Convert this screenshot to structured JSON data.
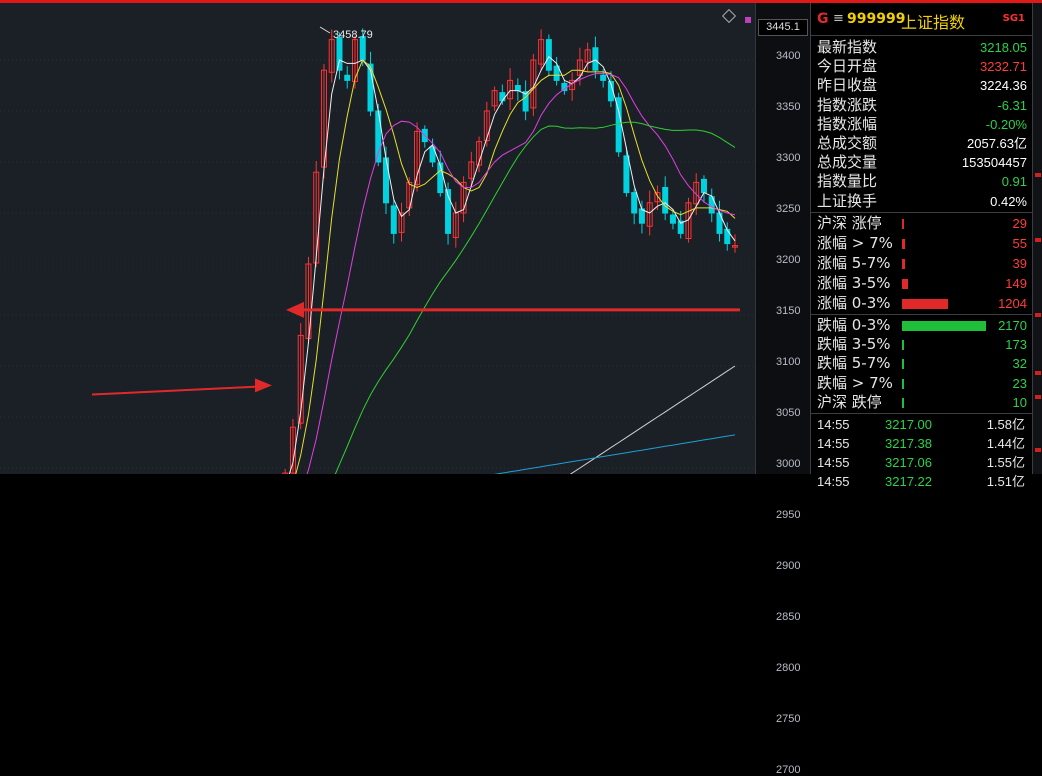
{
  "axis": {
    "top_box": "3445.1",
    "ticks": [
      "3400",
      "3350",
      "3300",
      "3250",
      "3200",
      "3150",
      "3100",
      "3050",
      "3000",
      "2950",
      "2900",
      "2850",
      "2800",
      "2750",
      "2700"
    ]
  },
  "chart": {
    "high_label": "3458.79",
    "colors": {
      "up": "#ff3333",
      "down": "#00d2e0",
      "ma5": "#f0f0f0",
      "ma10": "#e6e02a",
      "ma20": "#e040e0",
      "ma60": "#30d030",
      "ma120": "#d0d0d0",
      "ma250": "#1fa0d8",
      "arrow": "#e02a2a"
    }
  },
  "panel": {
    "g": "G",
    "menu_icon": "menu-icon",
    "code": "999999",
    "name": "上证指数",
    "sg": "SG1",
    "stats": [
      {
        "label": "最新指数",
        "value": "3218.05",
        "color": "#2ad24a"
      },
      {
        "label": "今日开盘",
        "value": "3232.71",
        "color": "#ff3b3b"
      },
      {
        "label": "昨日收盘",
        "value": "3224.36",
        "color": "#ffffff"
      },
      {
        "label": "指数涨跌",
        "value": "-6.31",
        "color": "#2ad24a"
      },
      {
        "label": "指数涨幅",
        "value": "-0.20%",
        "color": "#2ad24a"
      },
      {
        "label": "总成交额",
        "value": "2057.63亿",
        "color": "#ffffff"
      },
      {
        "label": "总成交量",
        "value": "153504457",
        "color": "#ffffff"
      },
      {
        "label": "指数量比",
        "value": "0.91",
        "color": "#2ad24a"
      },
      {
        "label": "上证换手",
        "value": "0.42%",
        "color": "#ffffff"
      }
    ],
    "up_dist": [
      {
        "label": "沪深 涨停",
        "value": "29",
        "frac": 0.02
      },
      {
        "label": "涨幅 > 7%",
        "value": "55",
        "frac": 0.04
      },
      {
        "label": "涨幅 5-7%",
        "value": "39",
        "frac": 0.03
      },
      {
        "label": "涨幅 3-5%",
        "value": "149",
        "frac": 0.07
      },
      {
        "label": "涨幅 0-3%",
        "value": "1204",
        "frac": 0.55
      }
    ],
    "down_dist": [
      {
        "label": "跌幅 0-3%",
        "value": "2170",
        "frac": 1.0
      },
      {
        "label": "跌幅 3-5%",
        "value": "173",
        "frac": 0.02
      },
      {
        "label": "跌幅 5-7%",
        "value": "32",
        "frac": 0.01
      },
      {
        "label": "跌幅 > 7%",
        "value": "23",
        "frac": 0.01
      },
      {
        "label": "沪深 跌停",
        "value": "10",
        "frac": 0.01
      }
    ],
    "ticks_list": [
      {
        "time": "14:55",
        "price": "3217.00",
        "vol": "1.58亿"
      },
      {
        "time": "14:55",
        "price": "3217.38",
        "vol": "1.44亿"
      },
      {
        "time": "14:55",
        "price": "3217.06",
        "vol": "1.55亿"
      },
      {
        "time": "14:55",
        "price": "3217.22",
        "vol": "1.51亿"
      }
    ]
  }
}
